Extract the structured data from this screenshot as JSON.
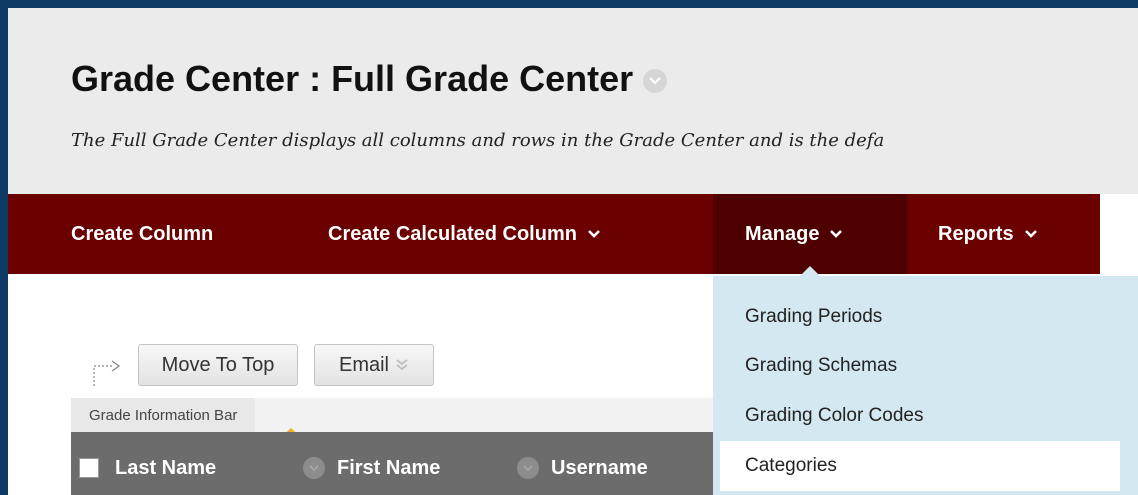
{
  "header": {
    "title": "Grade Center : Full Grade Center",
    "description": "The Full Grade Center displays all columns and rows in the Grade Center and is the defa"
  },
  "action_bar": {
    "items": [
      {
        "label": "Create Column"
      },
      {
        "label": "Create Calculated Column"
      },
      {
        "label": "Manage"
      },
      {
        "label": "Reports"
      }
    ]
  },
  "manage_menu": {
    "items": [
      {
        "label": "Grading Periods"
      },
      {
        "label": "Grading Schemas"
      },
      {
        "label": "Grading Color Codes"
      },
      {
        "label": "Categories"
      }
    ]
  },
  "toolbar": {
    "move_to_top": "Move To Top",
    "email": "Email"
  },
  "info_bar": {
    "label": "Grade Information Bar"
  },
  "grid": {
    "columns": [
      "Last Name",
      "First Name",
      "Username"
    ]
  },
  "colors": {
    "action_bar": "#6b0000",
    "active_tab": "#4e0000",
    "menu_bg": "#d4e8f1",
    "grid_header": "#6c6c6c",
    "frame_border": "#0d3b66"
  }
}
